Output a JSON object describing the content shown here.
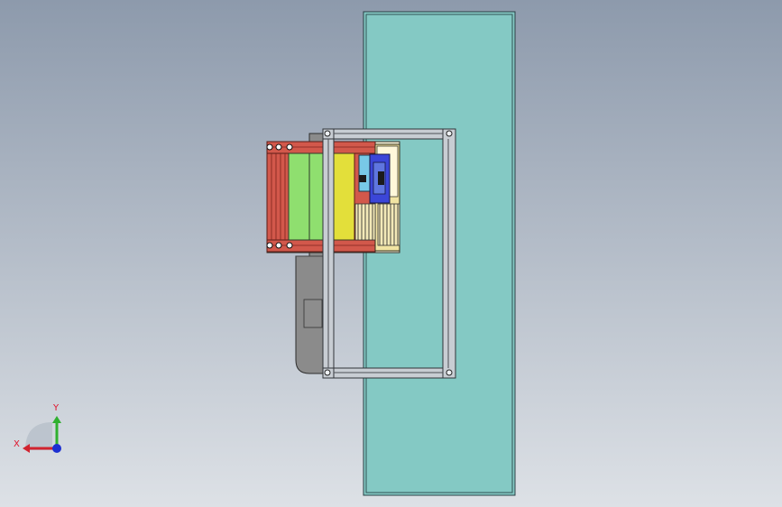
{
  "viewport": {
    "background_top": "#8d9aac",
    "background_bottom": "#dde1e6"
  },
  "triad": {
    "x_label": "X",
    "y_label": "Y",
    "x_color": "#d1232f",
    "y_color": "#2fb02f",
    "z_color": "#1c2fd1"
  },
  "model": {
    "panel_color": "#84c9c4",
    "frame_color": "#c8cdd3",
    "rail_red": "#d2584b",
    "green_zone": "#8fdf6f",
    "yellow_zone": "#e3df3a",
    "blue_module": "#3b46d8",
    "cyan_part": "#78c9e7",
    "gray_plate": "#8b8b8b"
  }
}
